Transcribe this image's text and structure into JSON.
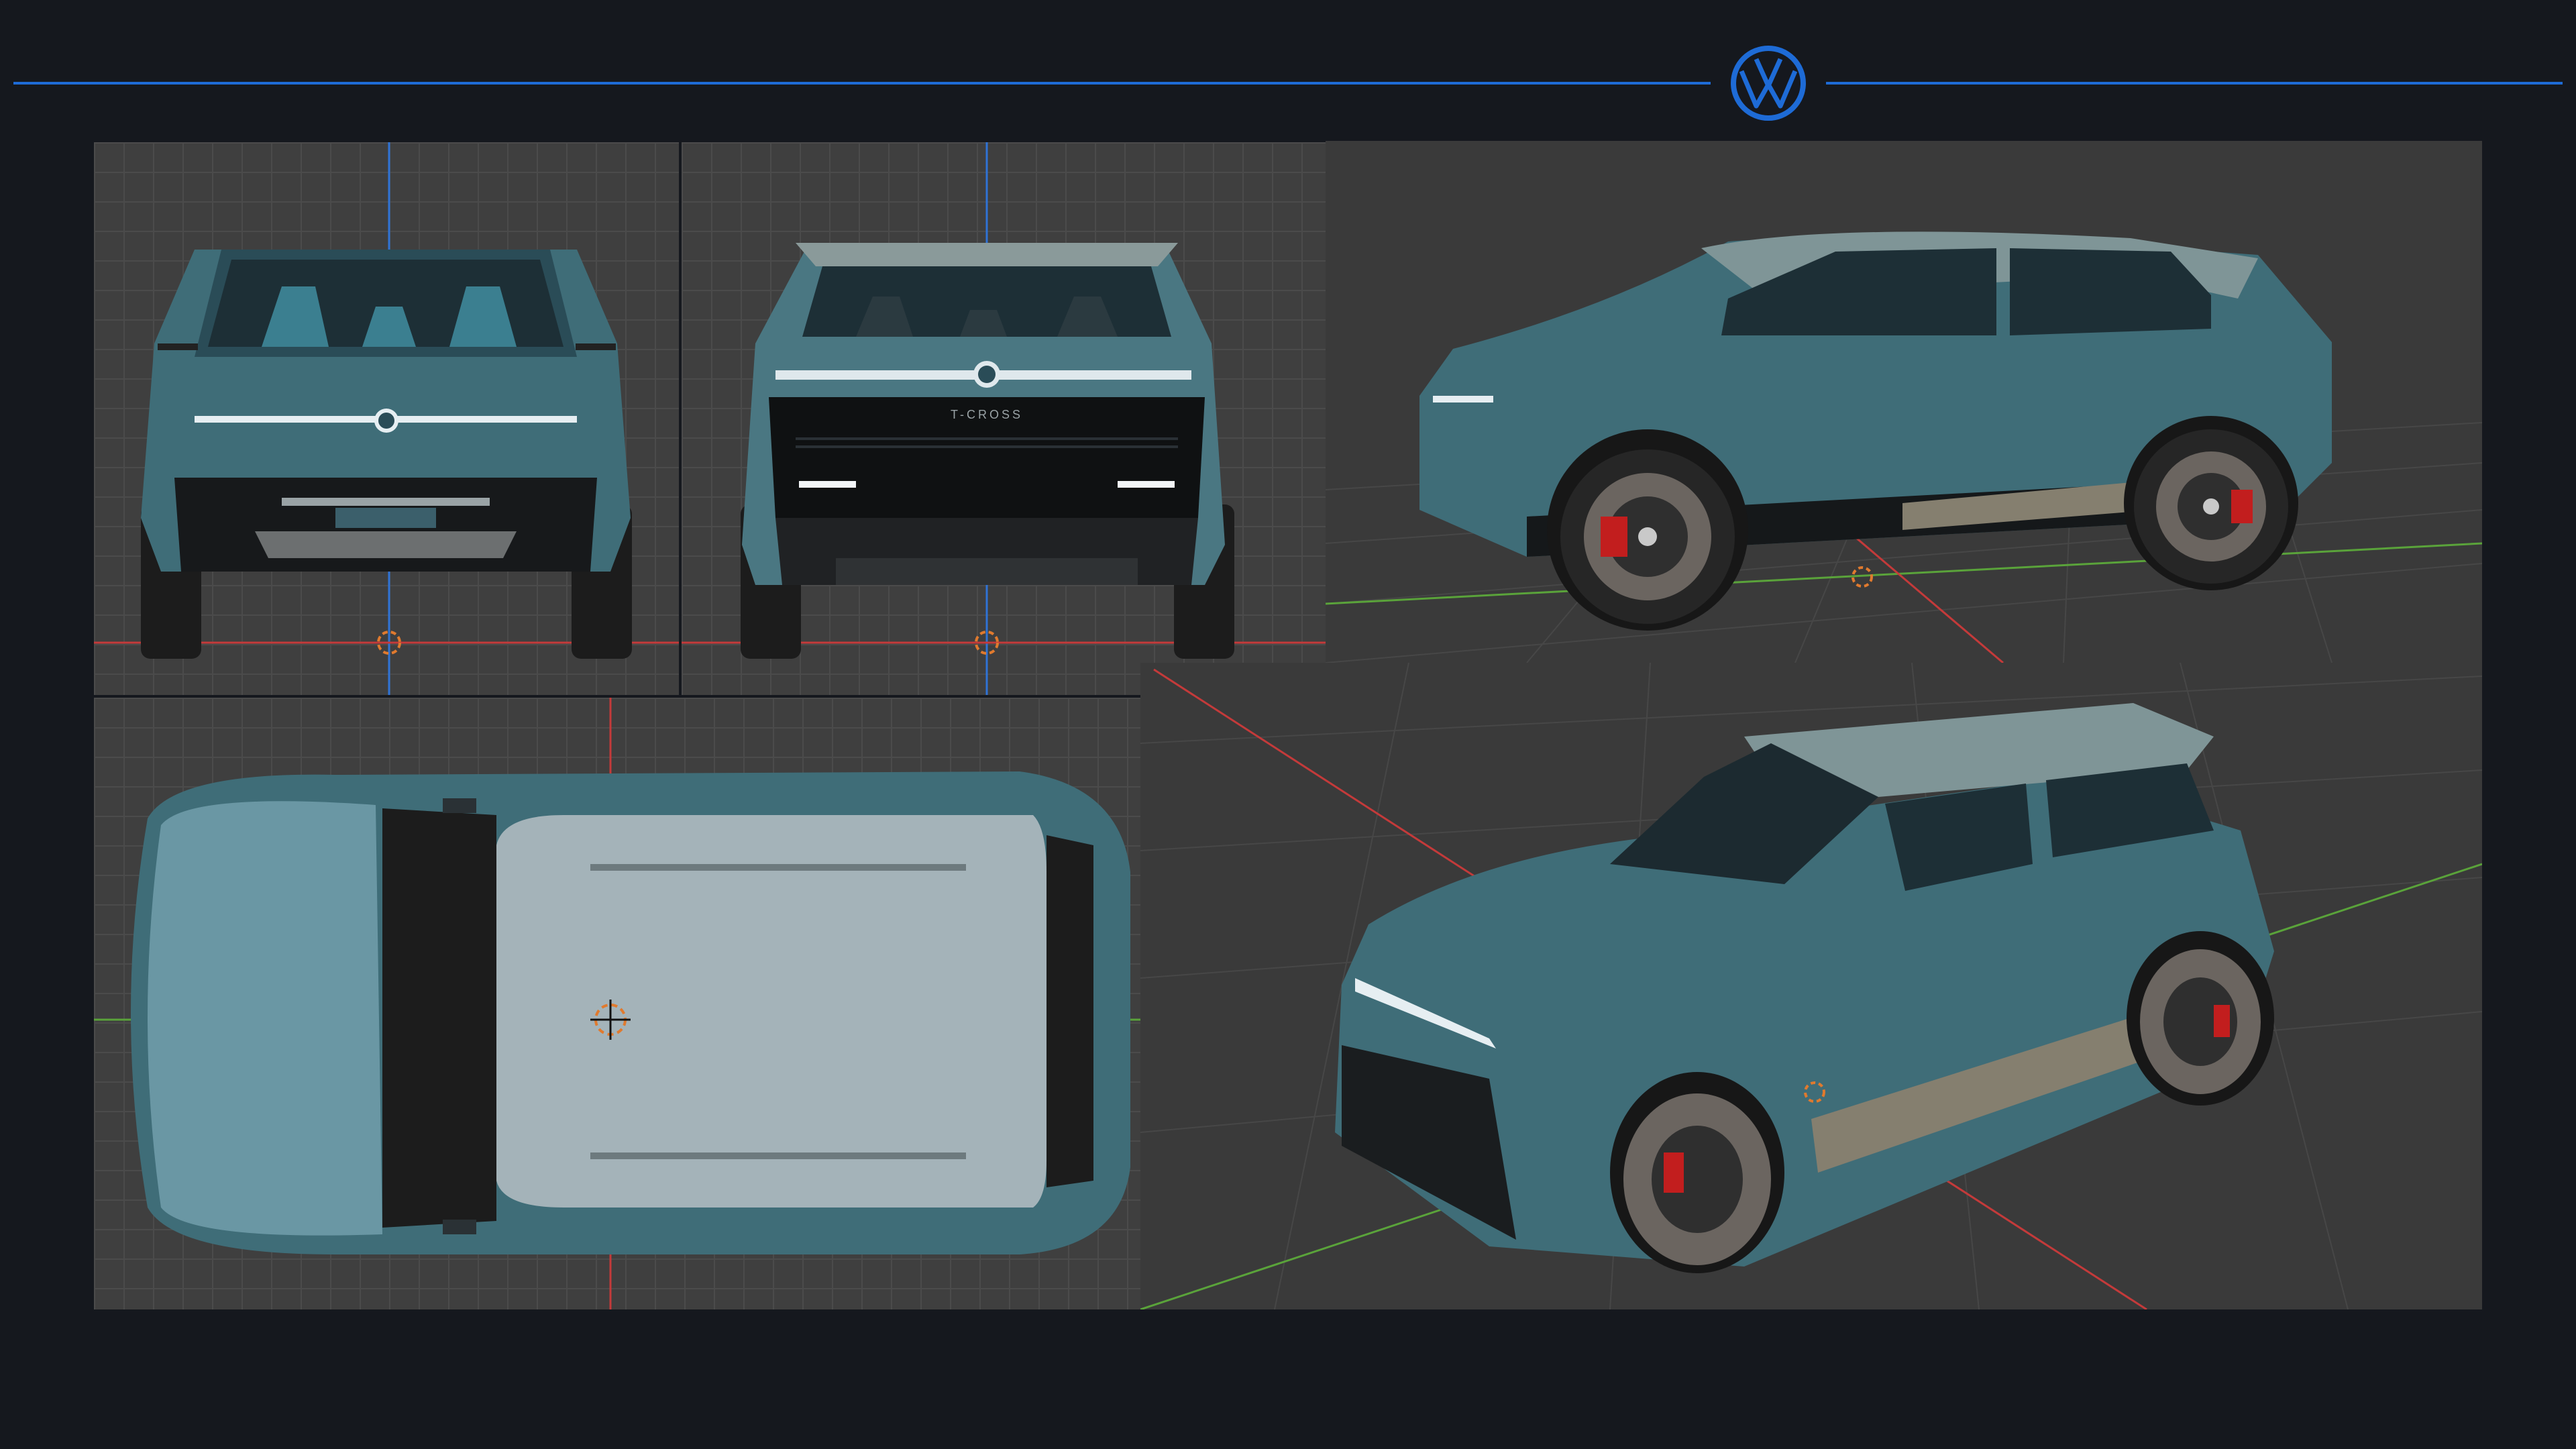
{
  "brand": {
    "logo_icon": "volkswagen-logo-icon",
    "accent_color": "#1e6bd6",
    "background_color": "#15181e"
  },
  "views": [
    {
      "name": "front-orthographic",
      "icon": "car-front-view"
    },
    {
      "name": "rear-orthographic",
      "icon": "car-rear-view"
    },
    {
      "name": "top-orthographic",
      "icon": "car-top-view"
    },
    {
      "name": "side-perspective",
      "icon": "car-side-view"
    },
    {
      "name": "three-quarter-perspective",
      "icon": "car-three-quarter-view"
    }
  ],
  "vehicle": {
    "rear_badge": "T-CROSS",
    "body_color": "#3f6d78",
    "roof_color": "#7f9597",
    "caliper_color": "#c21e1e"
  },
  "viewport": {
    "axis_x_color": "#c43a3a",
    "axis_y_color": "#5aa33a",
    "axis_z_color": "#2f73d6",
    "origin_marker_icon": "3d-cursor-icon"
  }
}
